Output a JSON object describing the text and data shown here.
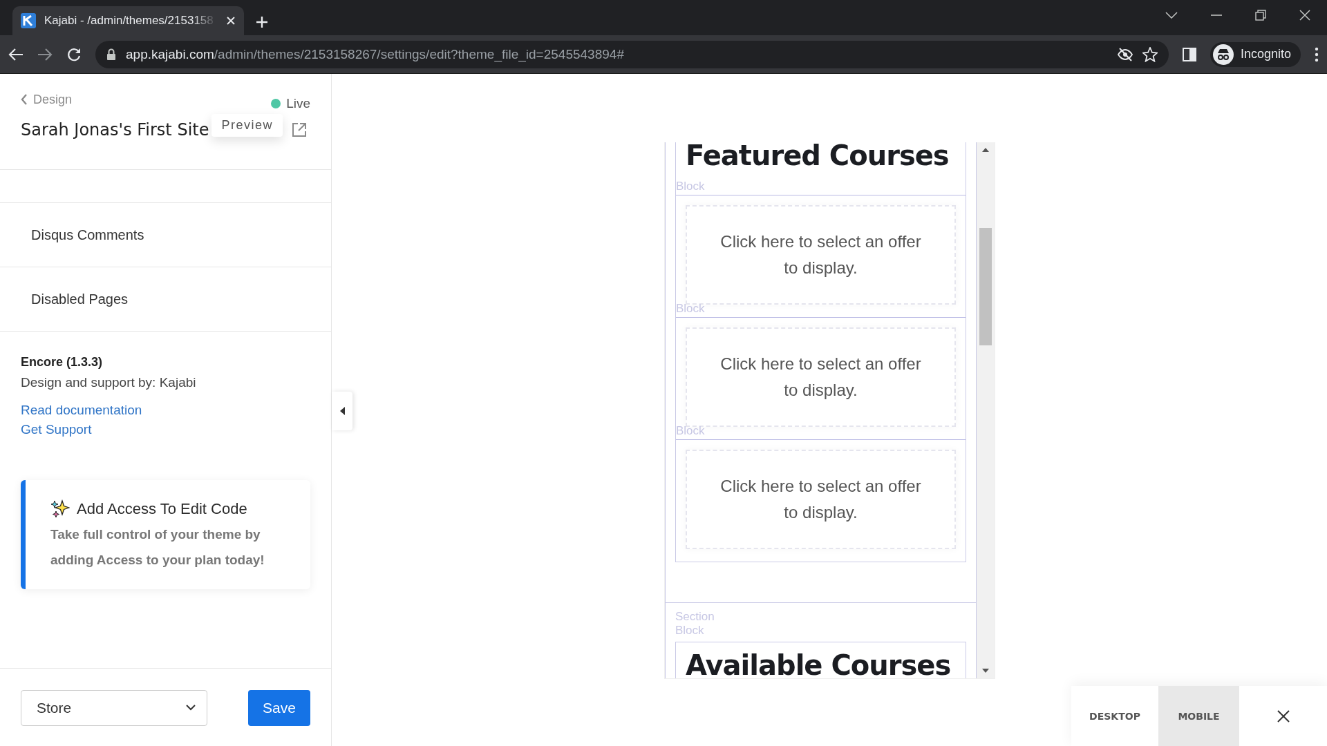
{
  "browser": {
    "tab_title": "Kajabi - /admin/themes/2153158",
    "url_host": "app.kajabi.com",
    "url_path": "/admin/themes/2153158267/settings/edit?theme_file_id=2545543894#",
    "profile": "Incognito"
  },
  "sidebar": {
    "back_link": "Design",
    "status": {
      "label": "Live",
      "color": "#4fc7a5"
    },
    "site_title": "Sarah Jonas's First Site",
    "preview_tooltip": "Preview",
    "settings_items": [
      "Disqus Comments",
      "Disabled Pages"
    ],
    "theme": {
      "name": "Encore (1.3.3)",
      "credit": "Design and support by: Kajabi",
      "links": [
        "Read documentation",
        "Get Support"
      ]
    },
    "promo": {
      "title": "Add Access To Edit Code",
      "body": "Take full control of your theme by adding Access to your plan today!"
    },
    "footer": {
      "select_value": "Store",
      "save": "Save"
    }
  },
  "preview": {
    "featured_heading": "Featured Courses",
    "block_labels": [
      "Block",
      "Block",
      "Block"
    ],
    "offers": [
      "Click here to select an offer to display.",
      "Click here to select an offer to display.",
      "Click here to select an offer to display."
    ],
    "next_section": {
      "section_label": "Section",
      "block_label": "Block",
      "heading": "Available Courses"
    }
  },
  "view_toggle": [
    {
      "label": "DESKTOP",
      "selected": false
    },
    {
      "label": "MOBILE",
      "selected": true
    }
  ]
}
